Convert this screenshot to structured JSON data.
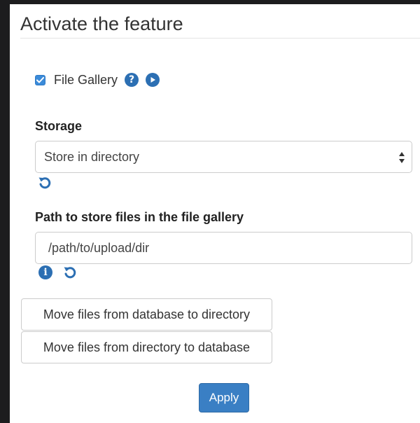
{
  "page": {
    "title": "Activate the feature"
  },
  "feature": {
    "checked": true,
    "label": "File Gallery",
    "help_icon": "question-circle-icon",
    "play_icon": "play-circle-icon"
  },
  "storage": {
    "label": "Storage",
    "selected": "Store in directory",
    "reset_icon": "reset-icon"
  },
  "path": {
    "label": "Path to store files in the file gallery",
    "value": "/path/to/upload/dir",
    "info_icon": "info-circle-icon",
    "reset_icon": "reset-icon"
  },
  "actions": {
    "move_db_to_dir": "Move files from database to directory",
    "move_dir_to_db": "Move files from directory to database",
    "apply": "Apply"
  },
  "colors": {
    "accent": "#3a7fc4",
    "icon": "#2c6fb3"
  }
}
